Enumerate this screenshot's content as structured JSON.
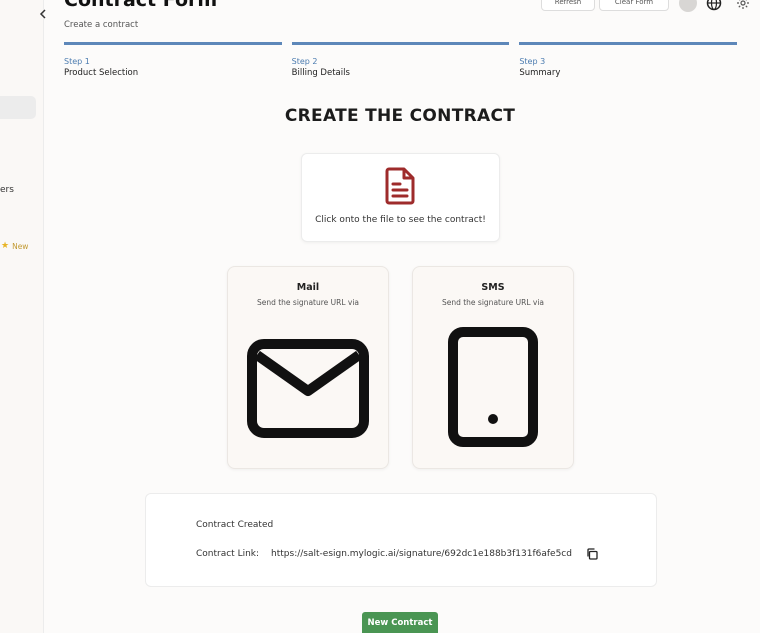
{
  "header": {
    "title": "Contract Form",
    "subtitle": "Create a contract",
    "buttons": [
      "Refresh",
      "Clear Form"
    ]
  },
  "sidebar": {
    "partial_label": "ers",
    "new_badge": "New"
  },
  "steps": [
    {
      "num": "Step 1",
      "label": "Product Selection"
    },
    {
      "num": "Step 2",
      "label": "Billing Details"
    },
    {
      "num": "Step 3",
      "label": "Summary"
    }
  ],
  "section_title": "CREATE THE CONTRACT",
  "file_card": {
    "text": "Click onto the file to see the contract!"
  },
  "send_options": {
    "mail": {
      "title": "Mail",
      "subtitle": "Send the signature URL via"
    },
    "sms": {
      "title": "SMS",
      "subtitle": "Send the signature URL via"
    }
  },
  "result": {
    "status": "Contract Created",
    "link_label": "Contract Link:",
    "link_url": "https://salt-esign.mylogic.ai/signature/692dc1e188b3f131f6afe5cd"
  },
  "new_contract_button": "New Contract",
  "colors": {
    "step_bar": "#5d87b9",
    "file_icon": "#9e2b2b",
    "primary_button": "#4a9553"
  }
}
